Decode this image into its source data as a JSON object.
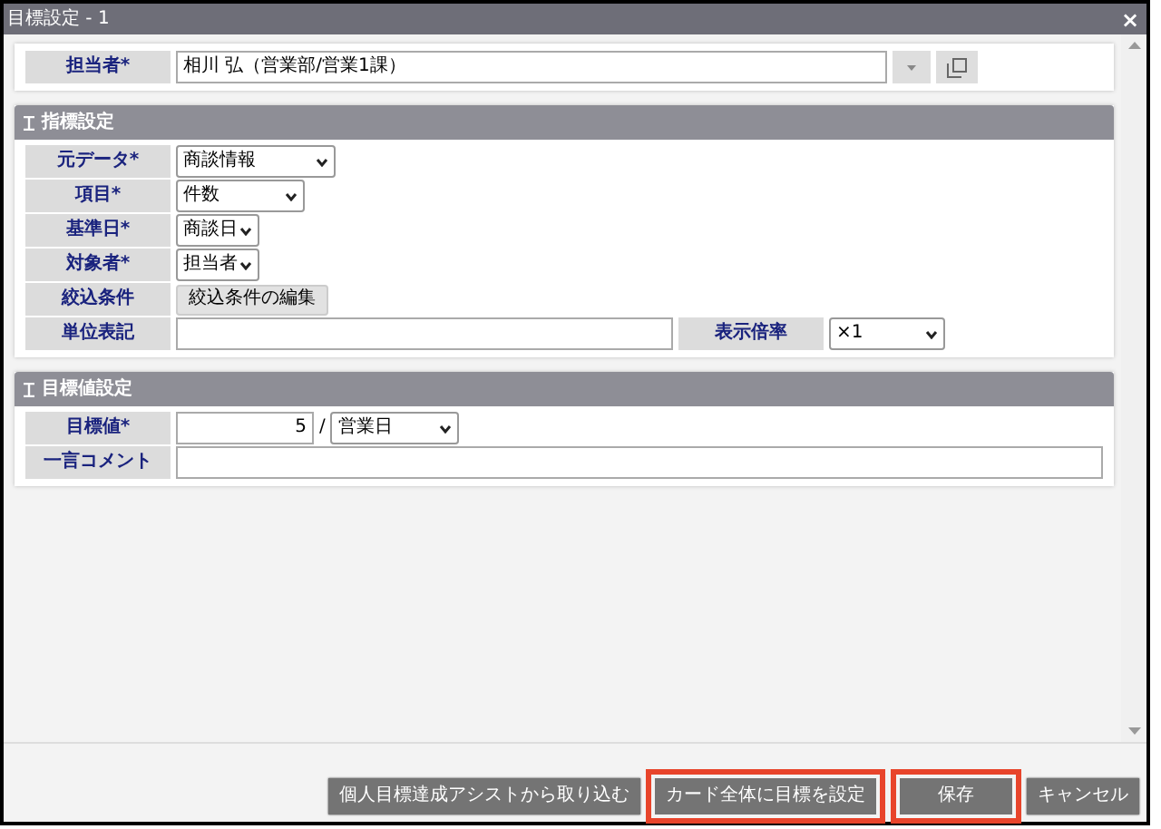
{
  "window": {
    "title": "目標設定 - 1",
    "close": "×"
  },
  "assignee": {
    "label": "担当者*",
    "value": "相川 弘（営業部/営業1課）"
  },
  "sections": [
    {
      "title": "指標設定",
      "rows": [
        {
          "kind": "select",
          "label": "元データ*",
          "value": "商談情報"
        },
        {
          "kind": "select",
          "label": "項目*",
          "value": "件数"
        },
        {
          "kind": "select",
          "label": "基準日*",
          "value": "商談日"
        },
        {
          "kind": "select",
          "label": "対象者*",
          "value": "担当者"
        },
        {
          "kind": "button",
          "label": "絞込条件",
          "button": "絞込条件の編集"
        },
        {
          "kind": "text_ratio",
          "label": "単位表記",
          "label_2": "表示倍率",
          "ratio": "×1"
        }
      ]
    },
    {
      "title": "目標値設定",
      "rows": [
        {
          "kind": "number_unit",
          "label": "目標値*",
          "value": "5",
          "separator": "/",
          "unit": "営業日"
        },
        {
          "kind": "text",
          "label": "一言コメント"
        }
      ]
    }
  ],
  "buttons": [
    {
      "label": "個人目標達成アシストから取り込む",
      "highlighted": false
    },
    {
      "label": "カード全体に目標を設定",
      "highlighted": true
    },
    {
      "label": "保存",
      "highlighted": true
    },
    {
      "label": "キャンセル",
      "highlighted": false
    }
  ]
}
